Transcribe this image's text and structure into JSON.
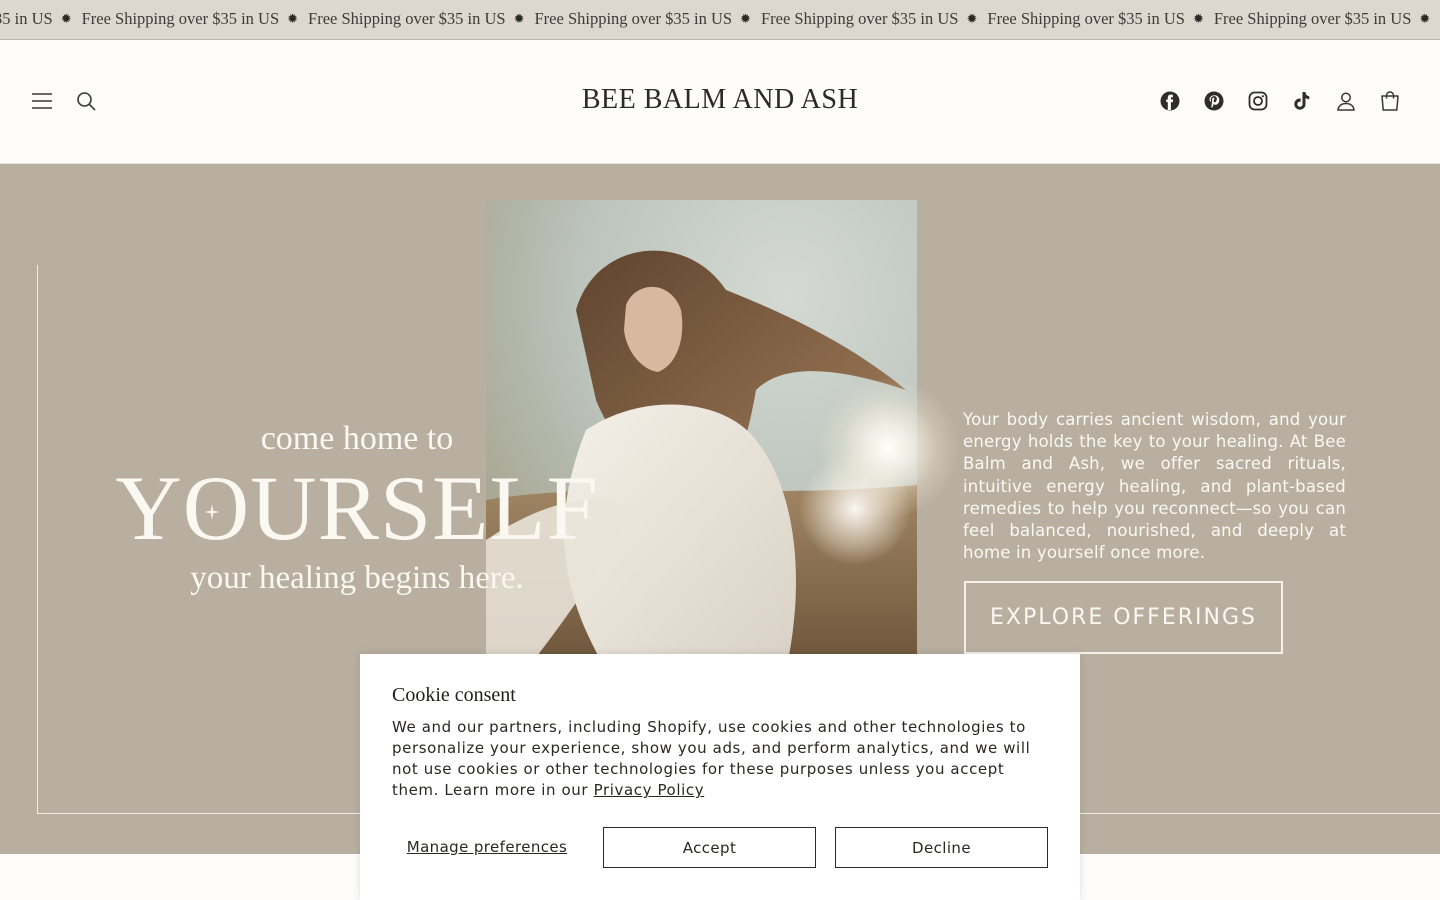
{
  "announcement": {
    "items": [
      "Free Shipping over $35 in US",
      "Free Shipping over $35 in US",
      "Free Shipping over $35 in US",
      "Free Shipping over $35 in US",
      "Free Shipping over $35 in US",
      "Free Shipping over $35 in US",
      "Free Shipping over $35 in US"
    ],
    "leading_fragment": "35 in US",
    "separator": "✹"
  },
  "header": {
    "brand": "BEE BALM AND ASH",
    "left_icons": [
      "menu-icon",
      "search-icon"
    ],
    "right_icons": [
      "facebook-icon",
      "pinterest-icon",
      "instagram-icon",
      "tiktok-icon",
      "account-icon",
      "cart-icon"
    ]
  },
  "hero": {
    "tagline_top": "come home to",
    "tagline_main": "YOURSELF",
    "tagline_bottom": "your healing begins here.",
    "body": "Your body carries ancient wisdom, and your energy holds the key to your healing. At Bee Balm and Ash, we offer sacred rituals, intuitive energy healing, and plant-based remedies to help you reconnect—so you can feel balanced, nourished, and deeply at home in yourself once more.",
    "cta_label": "EXPLORE OFFERINGS",
    "background_color": "#b9afa1"
  },
  "cookie": {
    "title": "Cookie consent",
    "text": "We and our partners, including Shopify, use cookies and other technologies to personalize your experience, show you ads, and perform analytics, and we will not use cookies or other technologies for these purposes unless you accept them. Learn more in our",
    "link_label": "Privacy Policy",
    "manage_label": "Manage preferences",
    "accept_label": "Accept",
    "decline_label": "Decline"
  }
}
